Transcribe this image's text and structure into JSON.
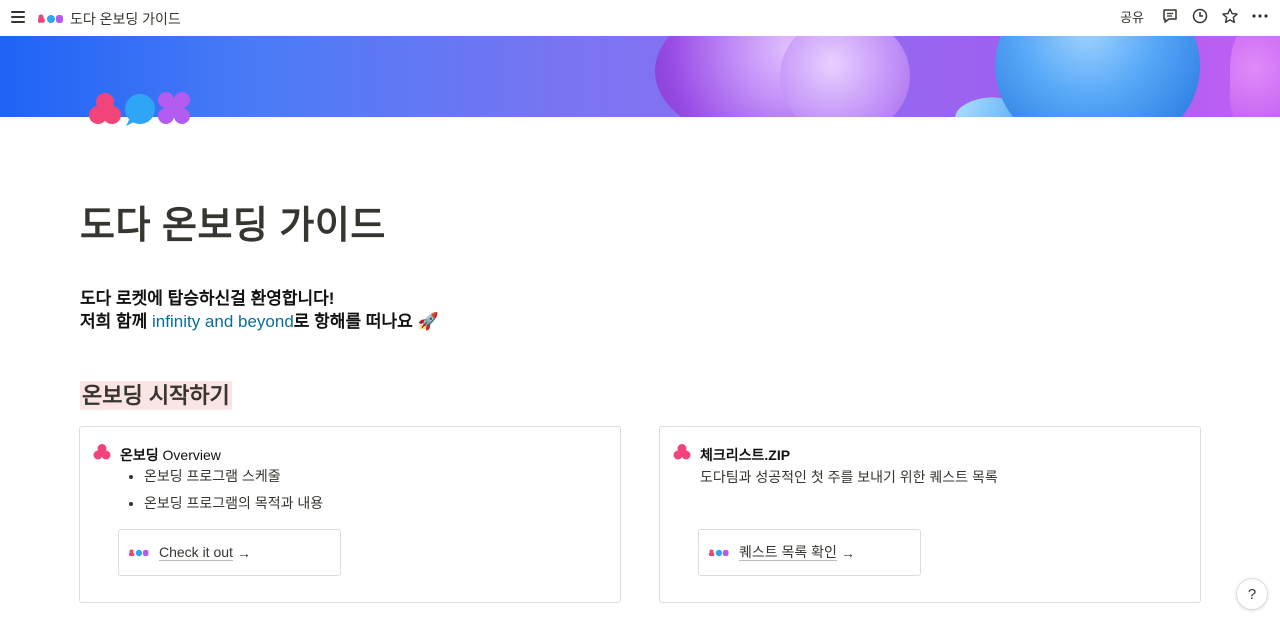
{
  "topbar": {
    "breadcrumb_title": "도다 온보딩 가이드",
    "share_label": "공유"
  },
  "page": {
    "title": "도다 온보딩 가이드",
    "intro_line1": "도다 로켓에 탑승하신걸 환영합니다!",
    "intro_line2_before": "저희 함께 ",
    "intro_link": "infinity and beyond",
    "intro_line2_after": "로 항해를 떠나요 🚀",
    "section_heading": "온보딩 시작하기"
  },
  "cards": [
    {
      "title_ko": "온보딩 ",
      "title_en": "Overview",
      "bullets": [
        "온보딩 프로그램 스케줄",
        "온보딩 프로그램의 목적과 내용"
      ],
      "link_label": "Check it out",
      "arrow": "→"
    },
    {
      "title": "체크리스트.ZIP",
      "description": "도다팀과 성공적인 첫 주를 보내기 위한 퀘스트 목록",
      "link_label": "퀘스트 목록 확인",
      "arrow": "→"
    }
  ],
  "help_label": "?",
  "colors": {
    "accent_link": "#0b6e99",
    "heading_highlight": "#fbe4e4",
    "logo_pink": "#f0447a",
    "logo_blue": "#2fa6f5",
    "logo_purple": "#b25cf0"
  },
  "icons": [
    "menu-icon",
    "comment-icon",
    "history-icon",
    "star-icon",
    "more-icon",
    "doda-logo-icon"
  ]
}
